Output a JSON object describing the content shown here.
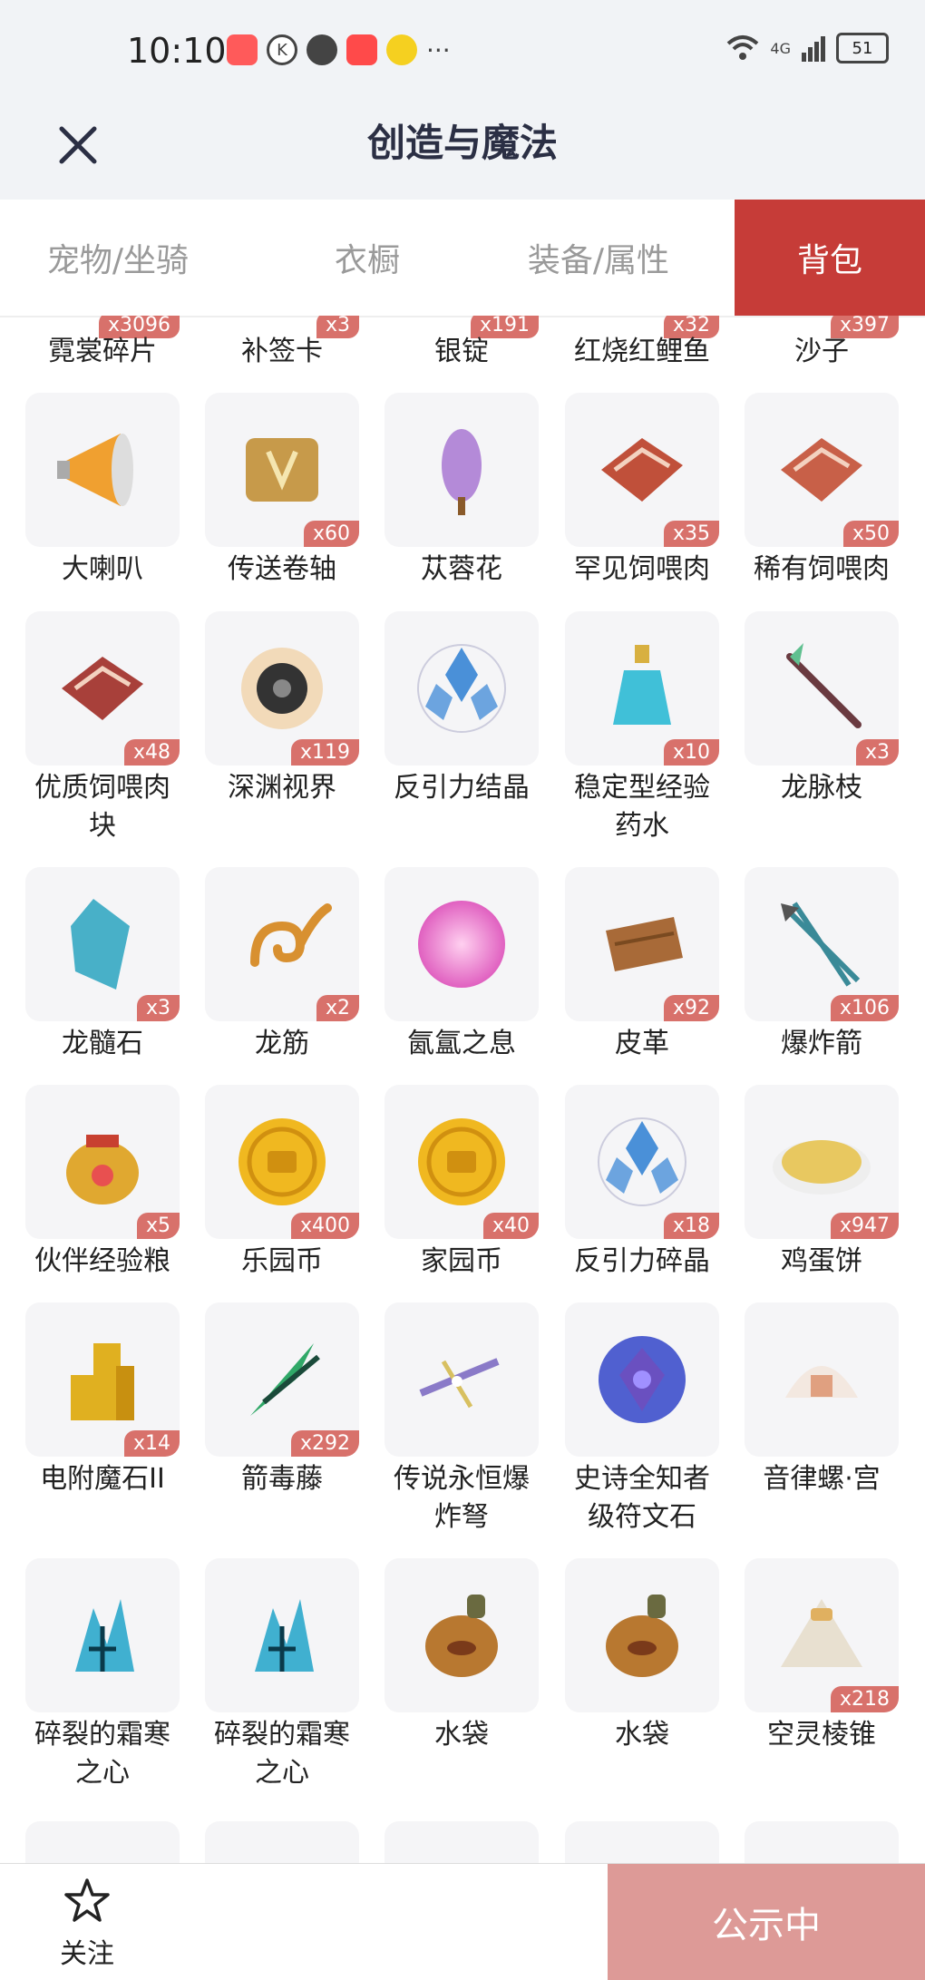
{
  "status": {
    "time": "10:10",
    "signal": "4G",
    "battery": "51"
  },
  "header": {
    "title": "创造与魔法"
  },
  "tabs": [
    "宠物/坐骑",
    "衣橱",
    "装备/属性",
    "背包"
  ],
  "top_row": [
    {
      "name": "霓裳碎片",
      "count": "x3096"
    },
    {
      "name": "补签卡",
      "count": "x3"
    },
    {
      "name": "银锭",
      "count": "x191"
    },
    {
      "name": "红烧红鲤鱼",
      "count": "x32"
    },
    {
      "name": "沙子",
      "count": "x397"
    }
  ],
  "items": [
    {
      "name": "大喇叭",
      "count": "",
      "icon": "megaphone-icon",
      "color": "#f0a030"
    },
    {
      "name": "传送卷轴",
      "count": "x60",
      "icon": "scroll-icon",
      "color": "#c79a4a"
    },
    {
      "name": "苁蓉花",
      "count": "",
      "icon": "flower-icon",
      "color": "#b48ad8"
    },
    {
      "name": "罕见饲喂肉",
      "count": "x35",
      "icon": "meat-icon",
      "color": "#c0503a"
    },
    {
      "name": "稀有饲喂肉",
      "count": "x50",
      "icon": "meat-icon",
      "color": "#c86048"
    },
    {
      "name": "优质饲喂肉块",
      "count": "x48",
      "icon": "meat-icon",
      "color": "#a8403a"
    },
    {
      "name": "深渊视界",
      "count": "x119",
      "icon": "eye-icon",
      "color": "#333333"
    },
    {
      "name": "反引力结晶",
      "count": "",
      "icon": "crystal-icon",
      "color": "#4a90d8"
    },
    {
      "name": "稳定型经验药水",
      "count": "x10",
      "icon": "potion-icon",
      "color": "#40c0d8"
    },
    {
      "name": "龙脉枝",
      "count": "x3",
      "icon": "branch-icon",
      "color": "#6a3a40"
    },
    {
      "name": "龙髓石",
      "count": "x3",
      "icon": "gem-icon",
      "color": "#48b0c8"
    },
    {
      "name": "龙筋",
      "count": "x2",
      "icon": "swirl-icon",
      "color": "#d89030"
    },
    {
      "name": "氤氲之息",
      "count": "",
      "icon": "orb-icon",
      "color": "#e060c0"
    },
    {
      "name": "皮革",
      "count": "x92",
      "icon": "leather-icon",
      "color": "#a86a38"
    },
    {
      "name": "爆炸箭",
      "count": "x106",
      "icon": "arrow-icon",
      "color": "#3a8a98"
    },
    {
      "name": "伙伴经验粮",
      "count": "x5",
      "icon": "bag-icon",
      "color": "#e0a830"
    },
    {
      "name": "乐园币",
      "count": "x400",
      "icon": "coin-icon",
      "color": "#f0b820"
    },
    {
      "name": "家园币",
      "count": "x40",
      "icon": "coin-icon",
      "color": "#f0b820"
    },
    {
      "name": "反引力碎晶",
      "count": "x18",
      "icon": "crystal-icon",
      "color": "#4a90d8"
    },
    {
      "name": "鸡蛋饼",
      "count": "x947",
      "icon": "pancake-icon",
      "color": "#e8c860"
    },
    {
      "name": "电附魔石II",
      "count": "x14",
      "icon": "ore-icon",
      "color": "#e0b020"
    },
    {
      "name": "箭毒藤",
      "count": "x292",
      "icon": "vine-icon",
      "color": "#30a868"
    },
    {
      "name": "传说永恒爆炸弩",
      "count": "",
      "icon": "crossbow-icon",
      "color": "#8a7ac8"
    },
    {
      "name": "史诗全知者级符文石",
      "count": "",
      "icon": "rune-icon",
      "color": "#6a50c0"
    },
    {
      "name": "音律螺·宫",
      "count": "",
      "icon": "shell-icon",
      "color": "#e0a080"
    },
    {
      "name": "碎裂的霜寒之心",
      "count": "",
      "icon": "frost-icon",
      "color": "#40b0d0"
    },
    {
      "name": "碎裂的霜寒之心",
      "count": "",
      "icon": "frost-icon",
      "color": "#40b0d0"
    },
    {
      "name": "水袋",
      "count": "",
      "icon": "waterbag-icon",
      "color": "#b87830"
    },
    {
      "name": "水袋",
      "count": "",
      "icon": "waterbag-icon",
      "color": "#b87830"
    },
    {
      "name": "空灵棱锥",
      "count": "x218",
      "icon": "pyramid-icon",
      "color": "#e8e0d0"
    }
  ],
  "bottom": {
    "follow_label": "关注",
    "public_label": "公示中"
  },
  "colors": {
    "accent": "#c63c38",
    "badge": "#d8716b",
    "public_btn": "#dd9a97"
  }
}
